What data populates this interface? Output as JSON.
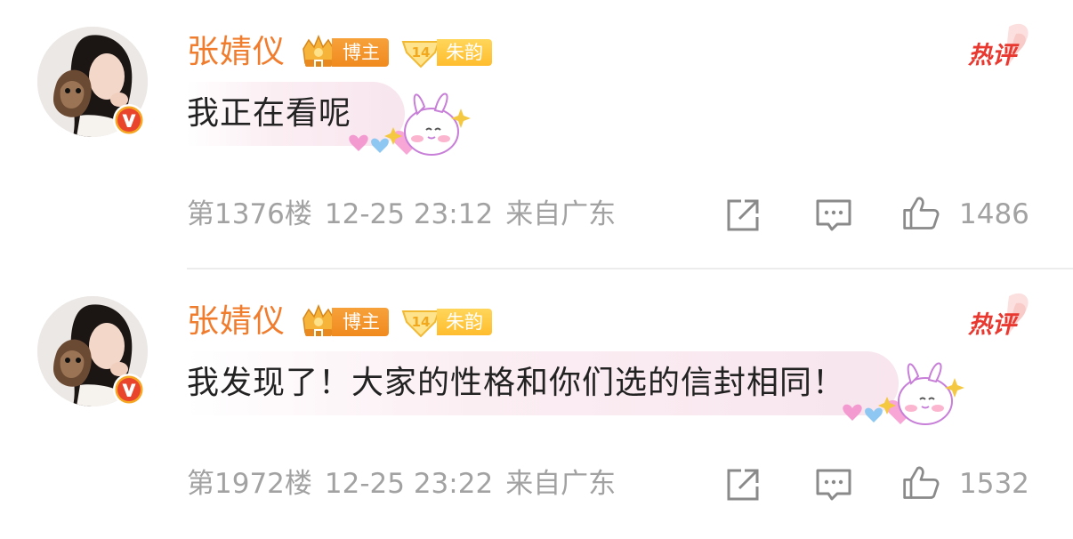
{
  "comments": [
    {
      "username": "张婧仪",
      "badge_blogger": "博主",
      "badge_fan_level": "14",
      "badge_fan_name": "朱韵",
      "hot_label": "热评",
      "text": "我正在看呢",
      "floor": "第1376楼",
      "datetime": "12-25 23:12",
      "location": "来自广东",
      "likes": "1486"
    },
    {
      "username": "张婧仪",
      "badge_blogger": "博主",
      "badge_fan_level": "14",
      "badge_fan_name": "朱韵",
      "hot_label": "热评",
      "text": "我发现了！大家的性格和你们选的信封相同！",
      "floor": "第1972楼",
      "datetime": "12-25 23:22",
      "location": "来自广东",
      "likes": "1532"
    }
  ],
  "colors": {
    "username": "#f07c2e",
    "hot": "#e8382f",
    "meta": "#a2a2a2",
    "verified": "#f5a623"
  },
  "icons": [
    "verified-v-icon",
    "crown-icon",
    "fan-level-icon",
    "bunny-sticker-icon",
    "share-icon",
    "comment-icon",
    "like-icon"
  ]
}
